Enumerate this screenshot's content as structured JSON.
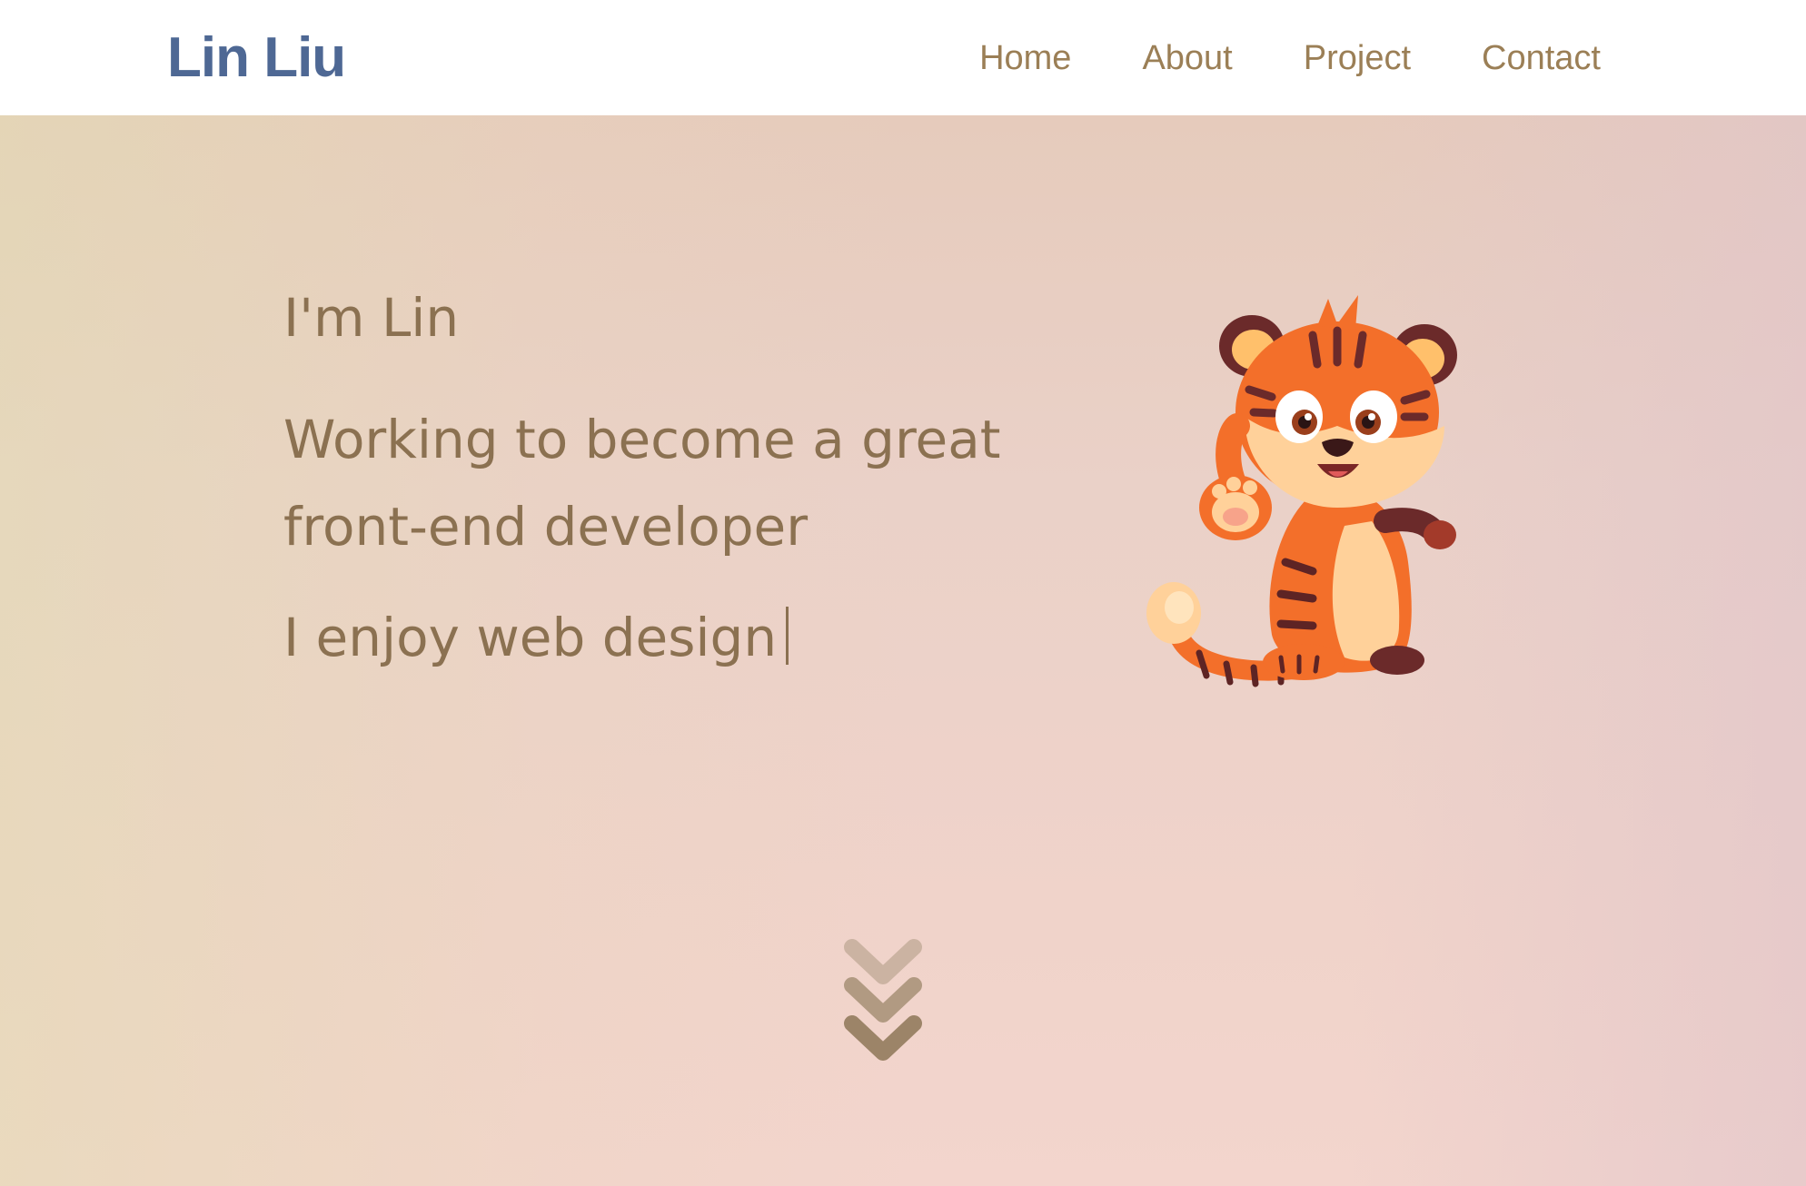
{
  "header": {
    "brand": "Lin Liu",
    "nav": [
      {
        "label": "Home"
      },
      {
        "label": "About"
      },
      {
        "label": "Project"
      },
      {
        "label": "Contact"
      }
    ]
  },
  "hero": {
    "greeting": "I'm Lin",
    "tagline": "Working to become a great front-end developer",
    "typing_text": "I enjoy web design",
    "illustration": "tiger-mascot",
    "scroll_icon": "chevrons-down-icon"
  },
  "colors": {
    "brand": "#4e6894",
    "nav_link": "#9b7f56",
    "hero_text": "#8b7151",
    "tiger_orange": "#f36f2a",
    "tiger_cream": "#ffd19a",
    "tiger_stripe": "#6b2a2a"
  }
}
